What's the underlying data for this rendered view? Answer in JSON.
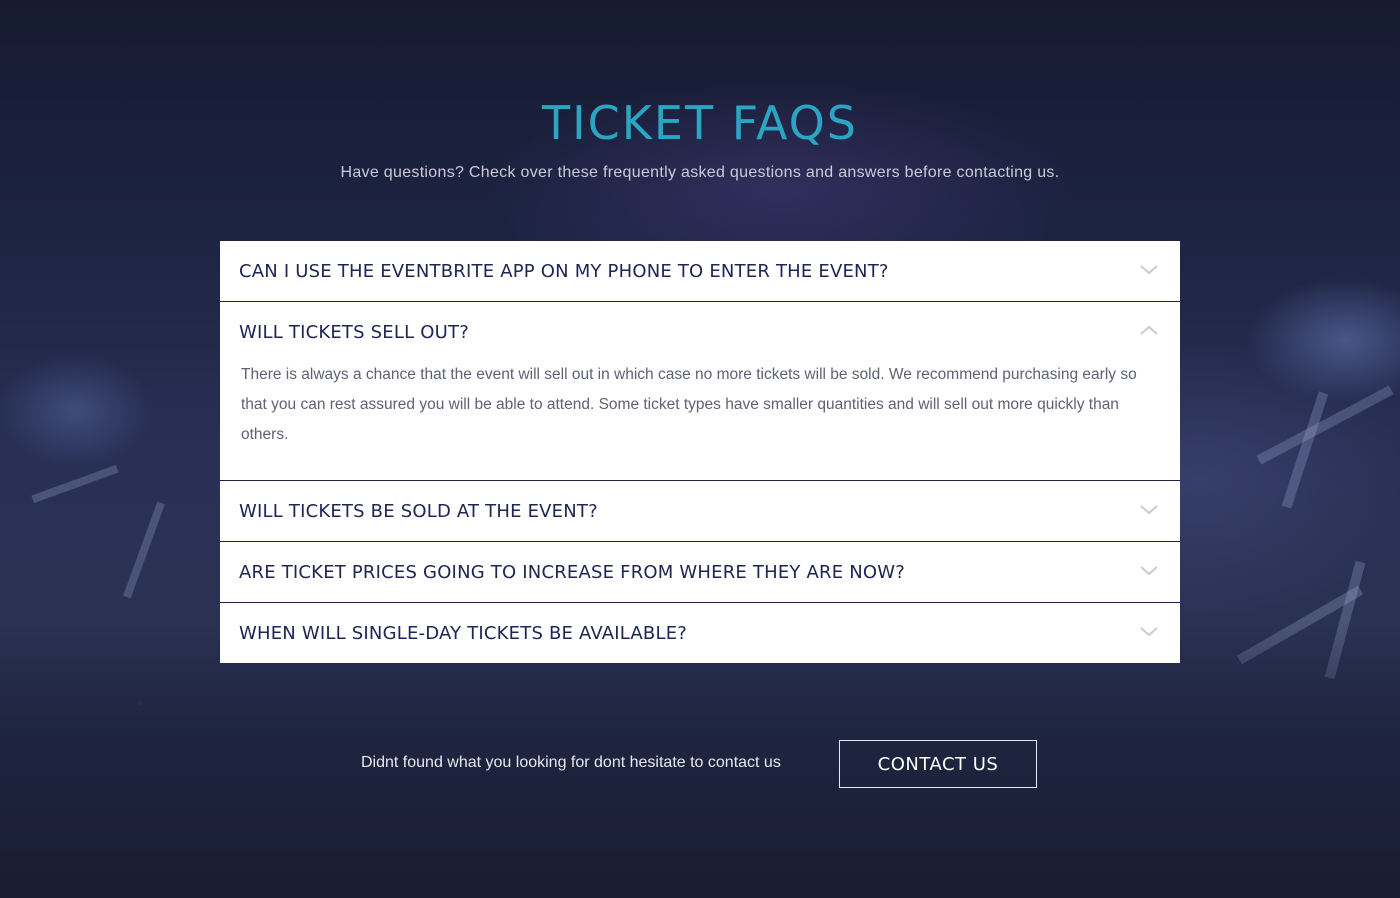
{
  "header": {
    "title": "TICKET FAQS",
    "subtitle": "Have questions? Check over these frequently asked questions and answers before contacting us."
  },
  "faq": {
    "items": [
      {
        "question": "CAN I USE THE EVENTBRITE APP ON MY PHONE TO ENTER THE EVENT?",
        "expanded": false,
        "icon": "chevron-down-icon"
      },
      {
        "question": "WILL TICKETS SELL OUT?",
        "expanded": true,
        "icon": "chevron-up-icon",
        "answer": "There is always a chance that the event will sell out in which case no more tickets will be sold. We recommend purchasing early so that you can rest assured you will be able to attend. Some ticket types have smaller quantities and will sell out more quickly than others."
      },
      {
        "question": "WILL TICKETS BE SOLD AT THE EVENT?",
        "expanded": false,
        "icon": "chevron-down-icon"
      },
      {
        "question": "ARE TICKET PRICES GOING TO INCREASE FROM WHERE THEY ARE NOW?",
        "expanded": false,
        "icon": "chevron-down-icon"
      },
      {
        "question": "WHEN WILL SINGLE-DAY TICKETS BE AVAILABLE?",
        "expanded": false,
        "icon": "chevron-down-icon"
      }
    ]
  },
  "contact": {
    "text": "Didnt found what you looking for dont hesitate to contact us",
    "button_label": "CONTACT US"
  },
  "colors": {
    "title": "#2aa6c2",
    "question_text": "#202654",
    "answer_text": "#5f6272",
    "chevron": "#c9ccd3",
    "background": "#1c2342"
  }
}
